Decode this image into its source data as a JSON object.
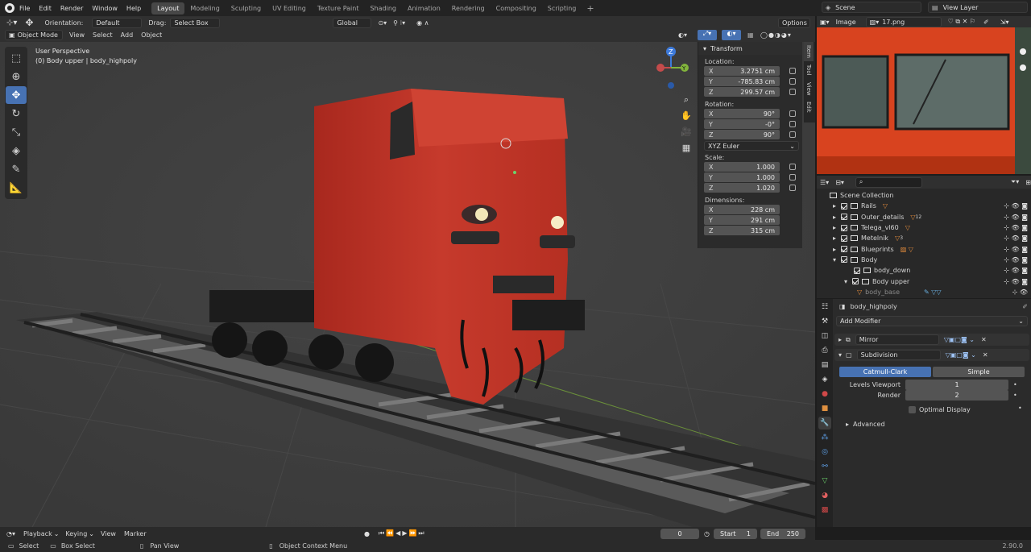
{
  "topbar": {
    "menus": [
      "File",
      "Edit",
      "Render",
      "Window",
      "Help"
    ],
    "workspaces": [
      "Layout",
      "Modeling",
      "Sculpting",
      "UV Editing",
      "Texture Paint",
      "Shading",
      "Animation",
      "Rendering",
      "Compositing",
      "Scripting"
    ],
    "active_workspace": "Layout",
    "plus": "+",
    "scene": "Scene",
    "view_layer": "View Layer"
  },
  "viewport_header": {
    "orientation_label": "Orientation:",
    "orientation_value": "Default",
    "drag_label": "Drag:",
    "drag_value": "Select Box",
    "transform_space": "Global",
    "options": "Options",
    "mode": "Object Mode",
    "menus": [
      "View",
      "Select",
      "Add",
      "Object"
    ]
  },
  "viewport": {
    "perspective": "User Perspective",
    "object_info": "(0) Body upper | body_highpoly",
    "gizmo": {
      "x": "X",
      "y": "Y",
      "z": "Z"
    }
  },
  "transform_panel": {
    "title": "Transform",
    "location_label": "Location:",
    "location": [
      {
        "axis": "X",
        "value": "3.2751 cm"
      },
      {
        "axis": "Y",
        "value": "-785.83 cm"
      },
      {
        "axis": "Z",
        "value": "299.57 cm"
      }
    ],
    "rotation_label": "Rotation:",
    "rotation": [
      {
        "axis": "X",
        "value": "90°"
      },
      {
        "axis": "Y",
        "value": "-0°"
      },
      {
        "axis": "Z",
        "value": "90°"
      }
    ],
    "rotation_mode": "XYZ Euler",
    "scale_label": "Scale:",
    "scale": [
      {
        "axis": "X",
        "value": "1.000"
      },
      {
        "axis": "Y",
        "value": "1.000"
      },
      {
        "axis": "Z",
        "value": "1.020"
      }
    ],
    "dimensions_label": "Dimensions:",
    "dimensions": [
      {
        "axis": "X",
        "value": "228 cm"
      },
      {
        "axis": "Y",
        "value": "291 cm"
      },
      {
        "axis": "Z",
        "value": "315 cm"
      }
    ],
    "tabs": [
      "Item",
      "Tool",
      "View",
      "Edit"
    ]
  },
  "image_editor": {
    "menu": "Image",
    "file": "17.png"
  },
  "outliner": {
    "root": "Scene Collection",
    "items": [
      {
        "name": "Rails",
        "badge": ""
      },
      {
        "name": "Outer_details",
        "badge": "12"
      },
      {
        "name": "Telega_vl60",
        "badge": ""
      },
      {
        "name": "Metelnik",
        "badge": "3"
      },
      {
        "name": "Blueprints",
        "badge": ""
      },
      {
        "name": "Body",
        "badge": ""
      },
      {
        "name": "body_down",
        "badge": ""
      },
      {
        "name": "Body upper",
        "badge": ""
      },
      {
        "name": "body_base",
        "badge": ""
      }
    ]
  },
  "properties": {
    "object_name": "body_highpoly",
    "add_modifier": "Add Modifier",
    "modifiers": [
      "Mirror",
      "Subdivision"
    ],
    "subdiv_types": [
      "Catmull-Clark",
      "Simple"
    ],
    "levels_viewport_label": "Levels Viewport",
    "levels_viewport": "1",
    "render_label": "Render",
    "render": "2",
    "optimal_display": "Optimal Display",
    "advanced": "Advanced"
  },
  "timeline": {
    "menus": [
      "Playback",
      "Keying",
      "View",
      "Marker"
    ],
    "current_frame": "0",
    "start_label": "Start",
    "start": "1",
    "end_label": "End",
    "end": "250"
  },
  "statusbar": {
    "select": "Select",
    "box_select": "Box Select",
    "pan_view": "Pan View",
    "context_menu": "Object Context Menu",
    "version": "2.90.0"
  },
  "colors": {
    "accent": "#4772b3",
    "train_red": "#c8392b",
    "bg": "#3d3d3d"
  }
}
